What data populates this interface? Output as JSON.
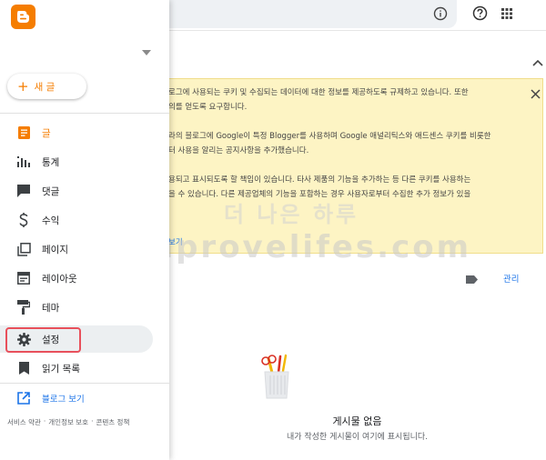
{
  "colors": {
    "brand": "#f57d00",
    "link": "#1a73e8",
    "notice_bg": "#fdf4c4",
    "highlight": "#e8505b",
    "selected_bg": "#eceff1"
  },
  "topbar": {
    "icons": [
      "info-icon",
      "help-icon",
      "apps-grid-icon"
    ]
  },
  "notice": {
    "lines": [
      "로그에 사용되는 쿠키 및 수집되는 데이터에 대한 정보를 제공하도록 규제하고 있습니다. 또한",
      "의를 얻도록 요구합니다.",
      "",
      "라의 블로그에 Google이 특정 Blogger를 사용하며 Google 애널리틱스와 애드센스 쿠키를 비롯한",
      "터 사용을 알리는 공지사항을 추가했습니다.",
      "",
      "용되고 표시되도록 할 책임이 있습니다. 타사 제품의 기능을 추가하는 등 다른 쿠키를 사용하는",
      "을 수 있습니다. 다른 제공업체의 기능을 포함하는 경우 사용자로부터 수집한 추가 정보가 있을"
    ],
    "link_text": "보기"
  },
  "content": {
    "manage_label": "관리",
    "empty_title": "게시물 없음",
    "empty_subtitle": "내가 작성한 게시물이 여기에 표시됩니다."
  },
  "watermark": {
    "line1": "더 나은 하루",
    "line2": "improvelifes.com"
  },
  "drawer": {
    "new_post_label": "새 글",
    "nav": [
      {
        "label": "글",
        "icon": "posts-icon",
        "active": true
      },
      {
        "label": "통계",
        "icon": "stats-icon"
      },
      {
        "label": "댓글",
        "icon": "comments-icon"
      },
      {
        "label": "수익",
        "icon": "earnings-icon"
      },
      {
        "label": "페이지",
        "icon": "pages-icon"
      },
      {
        "label": "레이아웃",
        "icon": "layout-icon"
      },
      {
        "label": "테마",
        "icon": "theme-icon"
      },
      {
        "label": "설정",
        "icon": "settings-icon",
        "selected": true
      },
      {
        "label": "읽기 목록",
        "icon": "reading-list-icon"
      }
    ],
    "view_blog_label": "블로그 보기",
    "footer": [
      "서비스 약관",
      "개인정보 보호",
      "콘텐츠 정책"
    ],
    "footer_separator": "·"
  }
}
